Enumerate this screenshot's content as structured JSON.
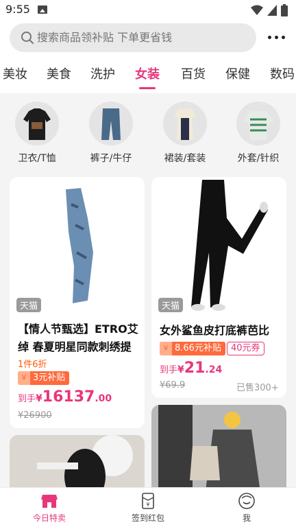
{
  "status": {
    "time": "9:55"
  },
  "search": {
    "placeholder": "搜索商品领补贴 下单更省钱"
  },
  "tabs": [
    {
      "label": "美妆"
    },
    {
      "label": "美食"
    },
    {
      "label": "洗护"
    },
    {
      "label": "女装",
      "active": true
    },
    {
      "label": "百货"
    },
    {
      "label": "保健"
    },
    {
      "label": "数码"
    }
  ],
  "subcategories": [
    {
      "label": "卫衣/T恤"
    },
    {
      "label": "裤子/牛仔"
    },
    {
      "label": "裙装/套装"
    },
    {
      "label": "外套/针织"
    }
  ],
  "products": [
    {
      "tag": "天猫",
      "title_line1": "【情人节甄选】ETRO艾",
      "title_line2": "绰 春夏明星同款刺绣提",
      "discount": "1件6折",
      "subsidy": "3元补贴",
      "price_prefix": "到手",
      "price_yen": "¥",
      "price_int": "16137",
      "price_dec": ".00",
      "original_price": "¥26900"
    },
    {
      "tag": "天猫",
      "title_line1": "女外鲨鱼皮打底裤芭比",
      "subsidy": "8.66元补贴",
      "coupon": "40元券",
      "price_prefix": "到手",
      "price_yen": "¥",
      "price_int": "21",
      "price_dec": ".24",
      "original_price": "¥69.9",
      "sold": "已售300+"
    }
  ],
  "nav": [
    {
      "label": "今日特卖",
      "icon": "shop-icon",
      "active": true
    },
    {
      "label": "签到红包",
      "icon": "red-packet-icon"
    },
    {
      "label": "我",
      "icon": "profile-icon"
    }
  ],
  "colors": {
    "accent": "#e8367b",
    "subsidy": "#ff6a3d",
    "discount": "#ff5a00"
  }
}
